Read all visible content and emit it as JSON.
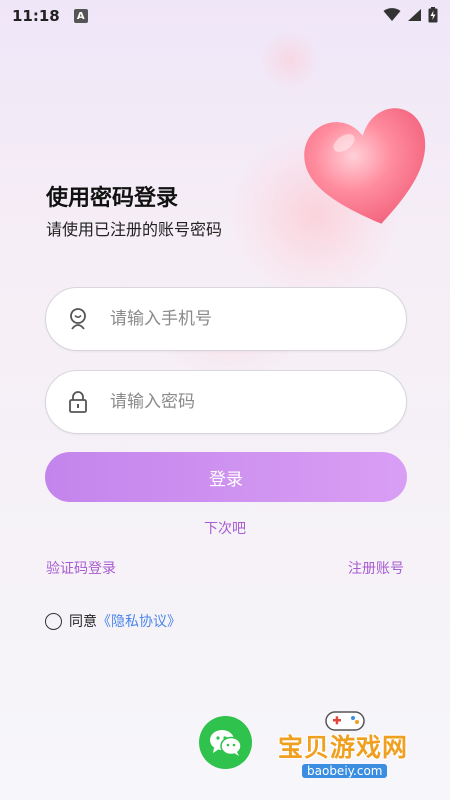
{
  "status_bar": {
    "time": "11:18",
    "a_badge": "A"
  },
  "login": {
    "title": "使用密码登录",
    "subtitle": "请使用已注册的账号密码",
    "phone_placeholder": "请输入手机号",
    "password_placeholder": "请输入密码",
    "login_button": "登录",
    "skip_link": "下次吧",
    "sms_login_link": "验证码登录",
    "register_link": "注册账号",
    "agree_text": "同意",
    "policy_link": "《隐私协议》"
  },
  "watermark": {
    "text": "宝贝游戏网",
    "url": "baobeiy.com"
  },
  "icons": {
    "phone_field": "user-avatar-icon",
    "password_field": "lock-icon",
    "social": "wechat-icon",
    "decoration": "heart-icon"
  },
  "colors": {
    "accent": "#a85cd2",
    "button_gradient_start": "#c385ec",
    "button_gradient_end": "#d99ef4",
    "policy_link": "#4a86e8",
    "wechat": "#2fc24d"
  }
}
